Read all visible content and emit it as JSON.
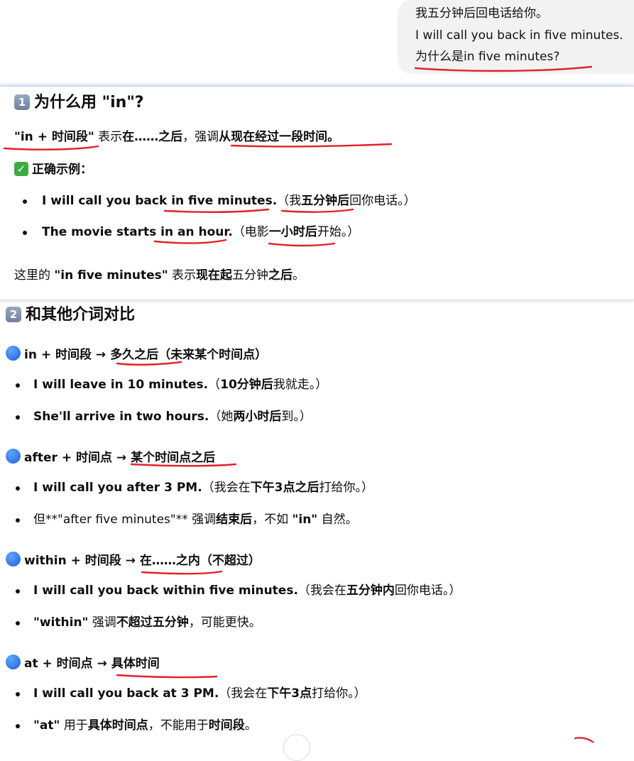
{
  "bubble": {
    "line1": "我五分钟后回电话给你。",
    "line2": "I will call you back in five minutes.",
    "line3": "为什么是in five minutes?"
  },
  "sec1": {
    "num": "1",
    "title": "为什么用 \"in\"?",
    "intro": {
      "a": "\"in + 时间段\"",
      "b": " 表示",
      "c": "在……之后",
      "d": "，强调",
      "e": "从现在经过一段时间。"
    },
    "correct_label": "正确示例：",
    "ex1": {
      "a": "I will call you back in five minutes.",
      "b": "（我",
      "c": "五分钟后",
      "d": "回你电话。）"
    },
    "ex2": {
      "a": "The movie starts in an hour.",
      "b": "（电影",
      "c": "一小时后",
      "d": "开始。）"
    },
    "note": {
      "a": "这里的 ",
      "b": "\"in five minutes\"",
      "c": " 表示",
      "d": "现在起",
      "e": "五分钟",
      "f": "之后",
      "g": "。"
    }
  },
  "sec2": {
    "num": "2",
    "title": "和其他介词对比",
    "g1": {
      "head": {
        "a": "in + 时间段 → 多久之后",
        "b": "（未来某个时间点）"
      },
      "i1": {
        "a": "I will leave in 10 minutes.",
        "b": "（",
        "c": "10分钟后",
        "d": "我就走。）"
      },
      "i2": {
        "a": "She'll arrive in two hours.",
        "b": "（她",
        "c": "两小时后",
        "d": "到。）"
      }
    },
    "g2": {
      "head": {
        "a": "after + 时间点 → 某个时间点之后"
      },
      "i1": {
        "a": "I will call you after 3 PM.",
        "b": "（我会在",
        "c": "下午3点之后",
        "d": "打给你。）"
      },
      "i2": {
        "a": "但**\"after five minutes\"** 强调",
        "b": "结束后",
        "c": "，不如 ",
        "d": "\"in\"",
        "e": " 自然。"
      }
    },
    "g3": {
      "head": {
        "a": "within + 时间段 → 在……之内",
        "b": "（不超过）"
      },
      "i1": {
        "a": "I will call you back within five minutes.",
        "b": "（我会在",
        "c": "五分钟内",
        "d": "回你电话。）"
      },
      "i2": {
        "a": "\"within\"",
        "b": " 强调",
        "c": "不超过五分钟",
        "d": "，可能更快。"
      }
    },
    "g4": {
      "head": {
        "a": "at + 时间点 → 具体时间"
      },
      "i1": {
        "a": "I will call you back at 3 PM.",
        "b": "（我会在",
        "c": "下午3点",
        "d": "打给你。）"
      },
      "i2": {
        "a": "\"at\"",
        "b": " 用于",
        "c": "具体时间点",
        "d": "，不能用于",
        "e": "时间段",
        "f": "。"
      }
    }
  },
  "icons": {
    "keycap": "keycap-number-icon",
    "check": "check-mark-button-icon",
    "dot": "blue-circle-icon",
    "bullet": "bullet-icon",
    "scroll": "scroll-down-button"
  },
  "colors": {
    "ink": "#e2212b",
    "bubble": "#f2f2f2",
    "dot": "#1f5fd6",
    "check": "#3dab3f"
  }
}
